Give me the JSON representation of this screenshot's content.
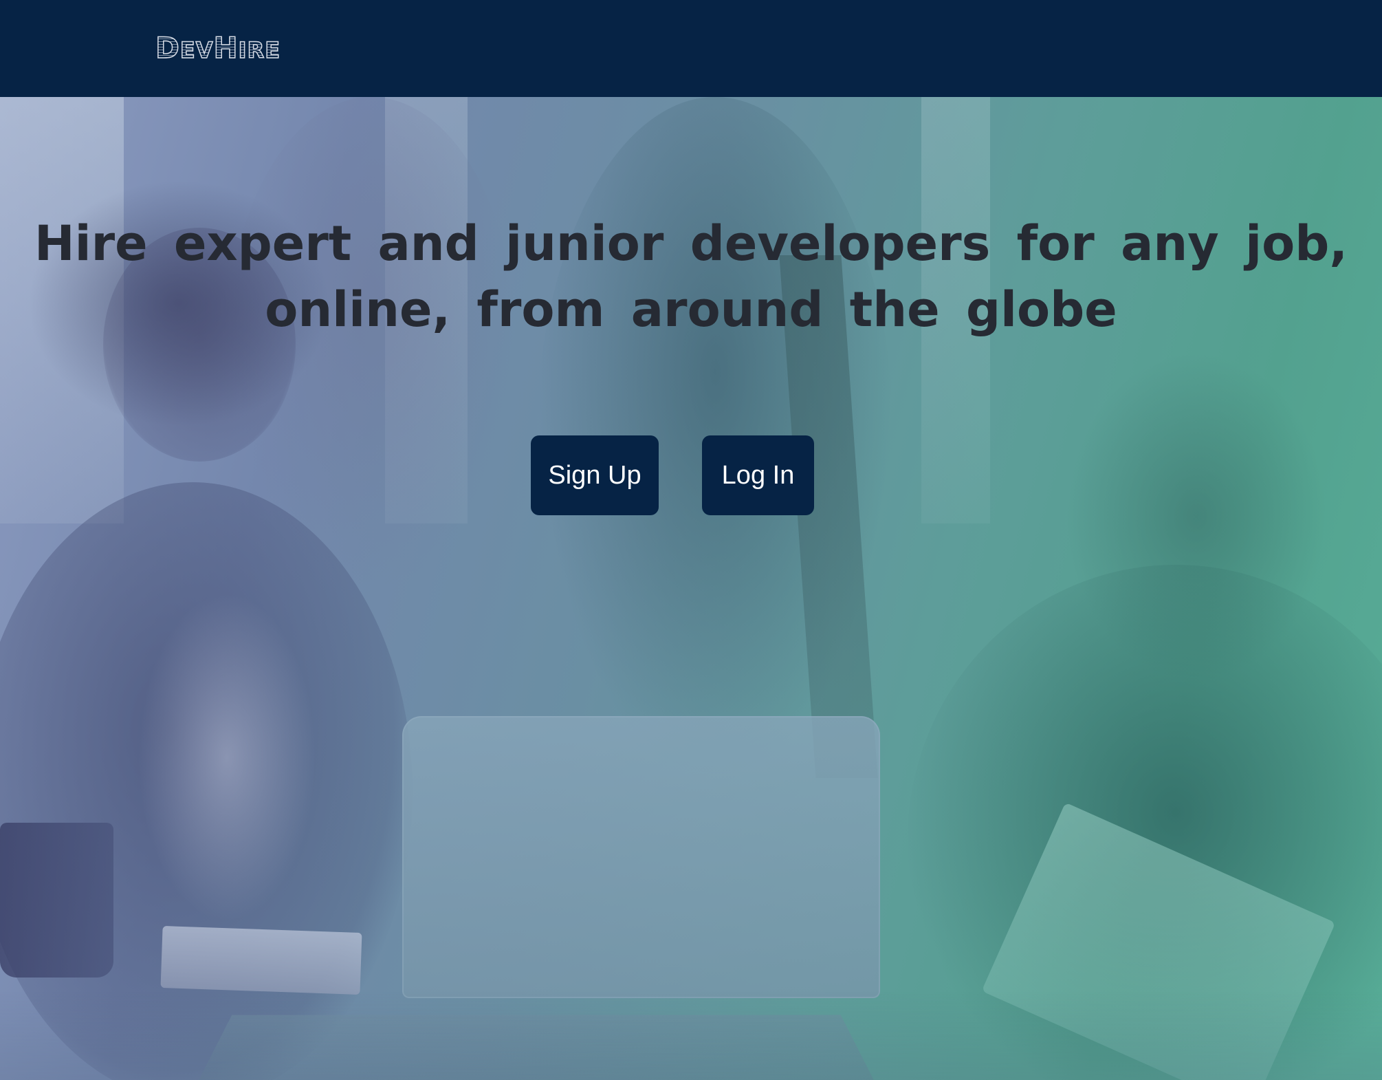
{
  "navbar": {
    "logo": "DevHire",
    "logo_parts": [
      "D",
      "EV",
      "H",
      "IRE"
    ],
    "background_color": "#062345"
  },
  "hero": {
    "headline": "Hire expert and junior developers for any job, online, from around the globe",
    "headline_color": "#262a33",
    "background_image_alt": "Team of professionals gathered around a laptop"
  },
  "actions": {
    "signup_label": "Sign Up",
    "login_label": "Log In",
    "button_color": "#062345"
  }
}
